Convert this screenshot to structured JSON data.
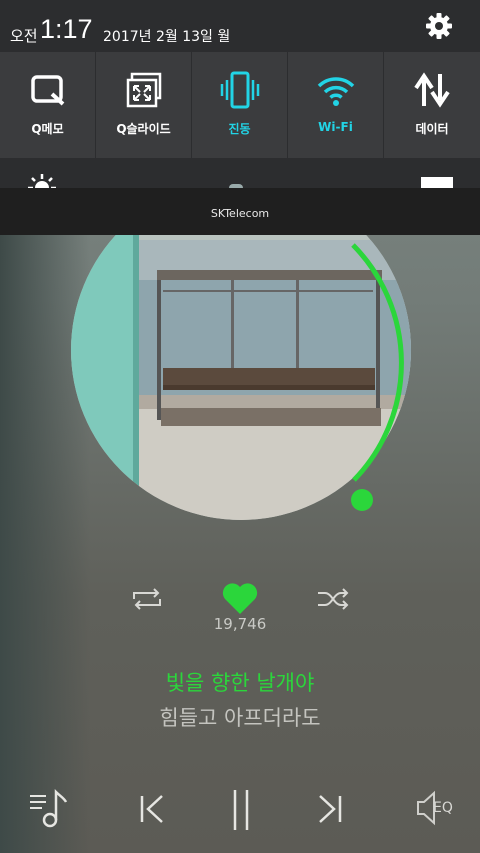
{
  "status_bar": {
    "ampm": "오전",
    "time": "1:17",
    "date": "2017년 2월 13일 월",
    "settings_icon": "gear-icon"
  },
  "quick_settings": [
    {
      "label": "Q메모",
      "icon": "qmemo-icon",
      "active": false
    },
    {
      "label": "Q슬라이드",
      "icon": "qslide-icon",
      "active": false
    },
    {
      "label": "진동",
      "icon": "vibrate-icon",
      "active": true
    },
    {
      "label": "Wi-Fi",
      "icon": "wifi-icon",
      "active": true
    },
    {
      "label": "데이터",
      "icon": "data-arrows-icon",
      "active": false
    }
  ],
  "carrier": "SKTelecom",
  "player": {
    "likes": "19,746",
    "lyric_current": "빛을 향한 날개야",
    "lyric_next": "힘들고 아프더라도",
    "eq_label": "EQ",
    "progress_fraction": 0.35
  },
  "colors": {
    "accent_green": "#2bd63b",
    "active_cyan": "#22d4e6",
    "panel_bg": "#2c2d2f",
    "tile_bg": "#3b3c3e"
  }
}
